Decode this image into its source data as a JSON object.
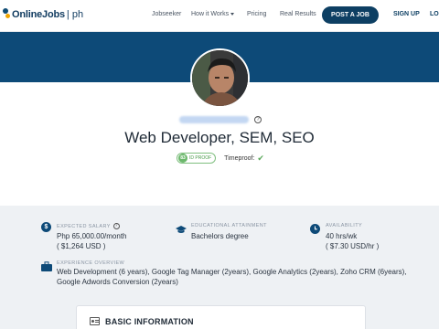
{
  "brand": {
    "name": "OnlineJobs",
    "suffix": "ph"
  },
  "nav": {
    "links": [
      "Jobseeker",
      "How it Works",
      "Pricing",
      "Real Results"
    ],
    "post_job": "POST A JOB",
    "sign_up": "SIGN UP",
    "login": "LO"
  },
  "profile": {
    "title": "Web Developer, SEM, SEO",
    "id_proof_score": "83",
    "id_proof_label": "ID PROOF",
    "timeproof_label": "Timeproof:",
    "timeproof_check": "✔"
  },
  "info": {
    "salary": {
      "label": "EXPECTED SALARY",
      "value": "Php 65,000.00/month",
      "sub": "( $1,264 USD )"
    },
    "education": {
      "label": "EDUCATIONAL ATTAINMENT",
      "value": "Bachelors degree"
    },
    "availability": {
      "label": "AVAILABILITY",
      "value": "40 hrs/wk",
      "sub": "( $7.30 USD/hr )"
    },
    "experience": {
      "label": "EXPERIENCE OVERVIEW",
      "line1": "Web Development (6 years), Google Tag Manager (2years), Google Analytics (2years), Zoho CRM (6years),",
      "line2": "Google Adwords Conversion (2years)"
    }
  },
  "basic_info": {
    "title": "BASIC INFORMATION"
  },
  "colors": {
    "brand_dark": "#0d4a78",
    "accent_green": "#5aa85a"
  }
}
